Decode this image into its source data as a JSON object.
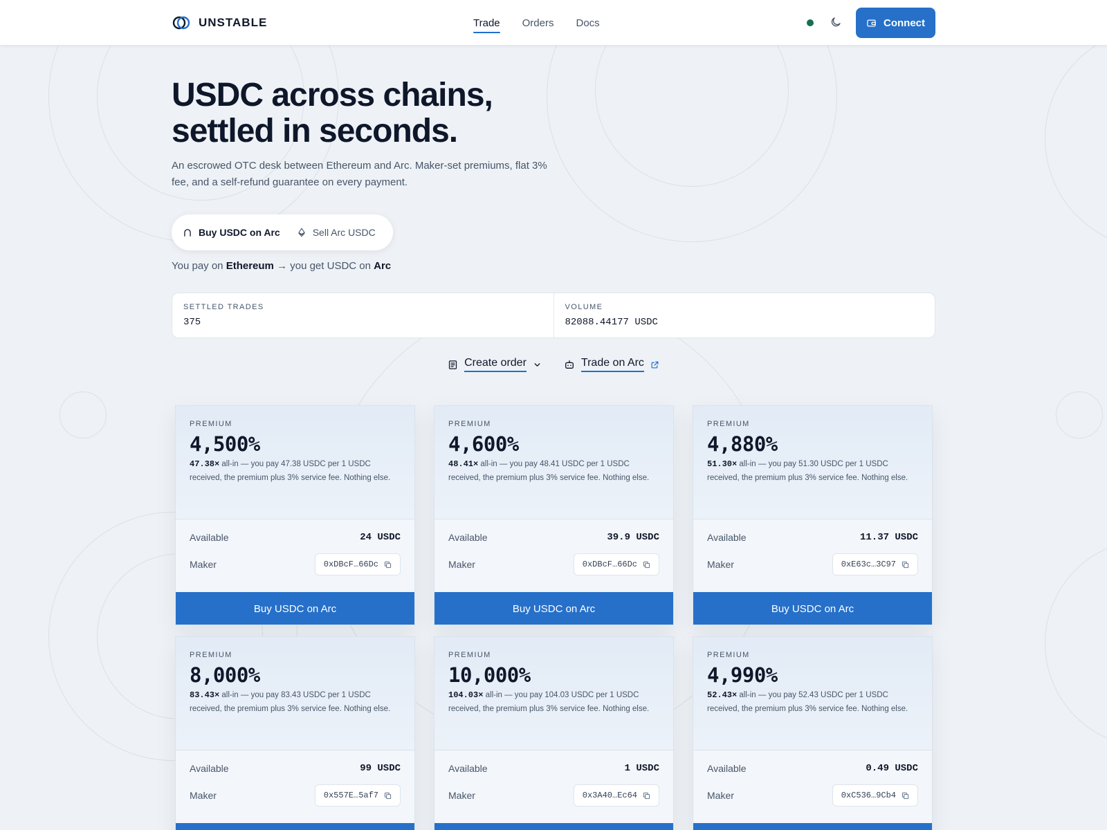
{
  "header": {
    "brand": "UNSTABLE",
    "nav": [
      {
        "label": "Trade",
        "active": true
      },
      {
        "label": "Orders",
        "active": false
      },
      {
        "label": "Docs",
        "active": false
      }
    ],
    "status_icon": "status-dot",
    "theme_icon": "moon-icon",
    "connect_label": "Connect"
  },
  "hero": {
    "title_line1": "USDC across chains,",
    "title_line2": "settled in seconds.",
    "subtitle": "An escrowed OTC desk between Ethereum and Arc. Maker-set premiums, flat 3% fee, and a self-refund guarantee on every payment."
  },
  "mode": {
    "buy_label": "Buy USDC on Arc",
    "sell_label": "Sell Arc USDC",
    "selected": "buy"
  },
  "flow": {
    "prefix": "You pay on",
    "source_chain": "Ethereum",
    "arrow": "→",
    "middle": "you get USDC on",
    "dest_chain": "Arc"
  },
  "stats": {
    "settled_label": "SETTLED TRADES",
    "settled_value": "375",
    "volume_label": "VOLUME",
    "volume_value": "82088.44177 USDC"
  },
  "actions": {
    "create_label": "Create order",
    "trade_label": "Trade on Arc"
  },
  "cards_common": {
    "premium_label": "PREMIUM",
    "available_label": "Available",
    "maker_label": "Maker",
    "button_label": "Buy USDC on Arc"
  },
  "cards": [
    {
      "premium": "4,500%",
      "mult": "47.38×",
      "desc": " all-in — you pay 47.38 USDC per 1 USDC received, the premium plus 3% service fee. Nothing else.",
      "available": "24 USDC",
      "maker": "0xDBcF…66Dc"
    },
    {
      "premium": "4,600%",
      "mult": "48.41×",
      "desc": " all-in — you pay 48.41 USDC per 1 USDC received, the premium plus 3% service fee. Nothing else.",
      "available": "39.9 USDC",
      "maker": "0xDBcF…66Dc"
    },
    {
      "premium": "4,880%",
      "mult": "51.30×",
      "desc": " all-in — you pay 51.30 USDC per 1 USDC received, the premium plus 3% service fee. Nothing else.",
      "available": "11.37 USDC",
      "maker": "0xE63c…3C97"
    },
    {
      "premium": "8,000%",
      "mult": "83.43×",
      "desc": " all-in — you pay 83.43 USDC per 1 USDC received, the premium plus 3% service fee. Nothing else.",
      "available": "99 USDC",
      "maker": "0x557E…5af7"
    },
    {
      "premium": "10,000%",
      "mult": "104.03×",
      "desc": " all-in — you pay 104.03 USDC per 1 USDC received, the premium plus 3% service fee. Nothing else.",
      "available": "1 USDC",
      "maker": "0x3A40…Ec64"
    },
    {
      "premium": "4,990%",
      "mult": "52.43×",
      "desc": " all-in — you pay 52.43 USDC per 1 USDC received, the premium plus 3% service fee. Nothing else.",
      "available": "0.49 USDC",
      "maker": "0xC536…9Cb4"
    }
  ],
  "colors": {
    "accent": "#2670c9",
    "text": "#0f172a",
    "muted": "#475569",
    "status": "#166f50",
    "background": "#eef2f6"
  }
}
